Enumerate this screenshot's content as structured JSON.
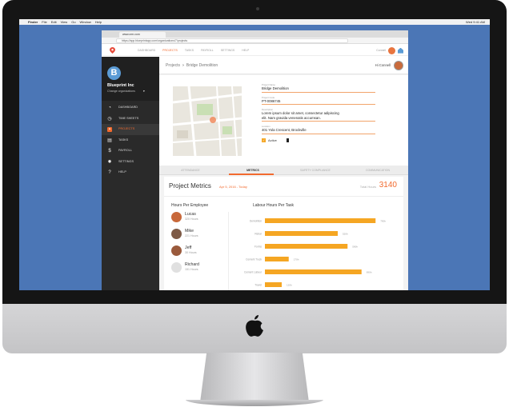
{
  "menubar": {
    "items": [
      "Finder",
      "File",
      "Edit",
      "View",
      "Go",
      "Window",
      "Help"
    ],
    "right_text": "Wed 9:41 AM"
  },
  "browser": {
    "tab_title": "www.crm.com",
    "url": "https://app.blueprintapp.com/organizations/7/projects"
  },
  "app_nav": {
    "items": [
      "DASHBOARD",
      "PROJECTS",
      "TASKS",
      "PAYROLL",
      "SETTINGS",
      "HELP"
    ],
    "active_index": 1,
    "right_label": "Connell"
  },
  "sidebar": {
    "org_name": "Blueprint Inc",
    "change_label": "Change organizations",
    "items": [
      {
        "label": "DASHBOARD",
        "icon": "speedometer-icon"
      },
      {
        "label": "TIME SHEETS",
        "icon": "clock-icon"
      },
      {
        "label": "PROJECTS",
        "icon": "folder-icon"
      },
      {
        "label": "TASKS",
        "icon": "tasks-icon"
      },
      {
        "label": "PAYROLL",
        "icon": "dollar-icon"
      },
      {
        "label": "SETTINGS",
        "icon": "gear-icon"
      },
      {
        "label": "HELP",
        "icon": "help-icon"
      }
    ],
    "active_index": 2
  },
  "breadcrumb": {
    "root": "Projects",
    "current": "Bridge Demolition",
    "greeting": "Hi Connell"
  },
  "project": {
    "name_label": "Project Name",
    "name": "Bridge Demolition",
    "code_label": "Project Code",
    "code": "PT-0086745",
    "desc_label": "Description",
    "desc_line1": "Lorem ipsum dolor sit amet, consectetur adipiscing",
    "desc_line2": "elit. Nam gravida venenatis accumsan.",
    "loc_label": "Location",
    "location": "401 Yola Crescent, Brockville",
    "active_label": "Active"
  },
  "tabs": [
    "ATTENDANCE",
    "METRICS",
    "SAFETY COMPLIANCE",
    "COMMUNICATION"
  ],
  "active_tab": 1,
  "metrics": {
    "title": "Project Metrics",
    "date_range": "Apr 5, 2016 - Today",
    "total_label": "Total Hours",
    "total_value": "3140",
    "hpe_title": "Hours Per Employee",
    "employees": [
      {
        "name": "Lucas",
        "hours": "320 Hours",
        "color": "#c8683a"
      },
      {
        "name": "Mike",
        "hours": "221 Hours",
        "color": "#7d5a46"
      },
      {
        "name": "Jeff",
        "hours": "30 Hours",
        "color": "#9a5a3c"
      },
      {
        "name": "Richard",
        "hours": "151 Hours",
        "color": "#e0e0e0"
      }
    ]
  },
  "chart_data": {
    "type": "bar",
    "title": "Labour Hours Per Task",
    "orientation": "horizontal",
    "categories": [
      "Demolition",
      "Rebar",
      "Forms",
      "Cement Truck",
      "Cement Labour",
      "Travel"
    ],
    "values": [
      790,
      520,
      590,
      170,
      690,
      120
    ],
    "value_labels": [
      "790h",
      "520h",
      "590h",
      "170h",
      "690h",
      "120h"
    ],
    "xlim": [
      0,
      800
    ],
    "color": "#f5a623"
  }
}
